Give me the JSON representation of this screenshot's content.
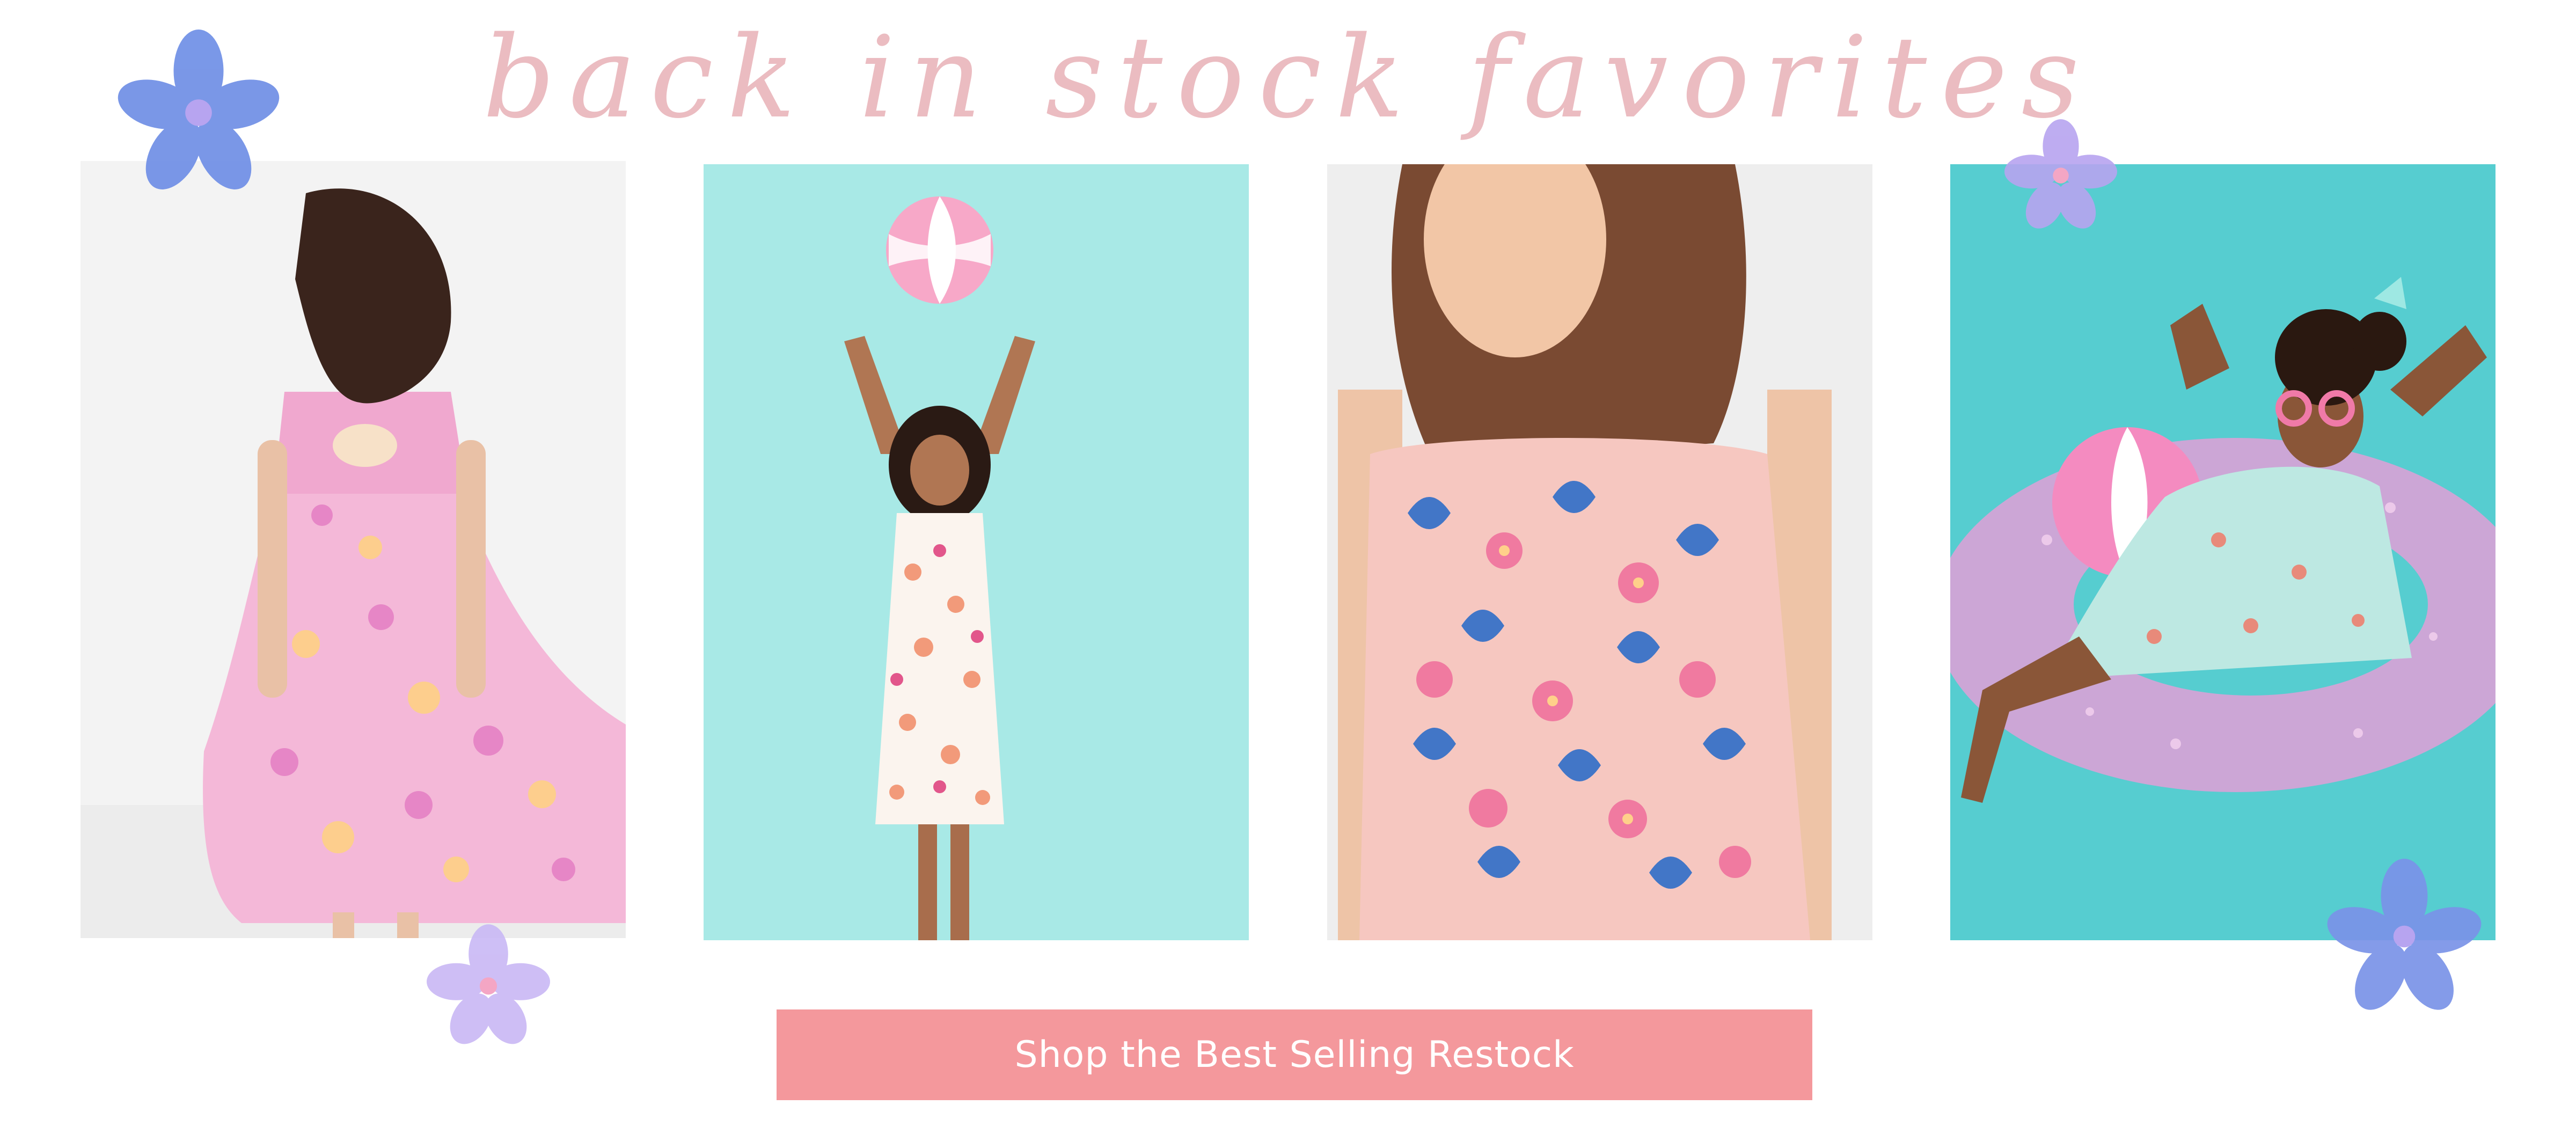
{
  "header": {
    "title": "back in stock favorites"
  },
  "gallery": {
    "photos": [
      {
        "subject": "Girl in pink floral tiered dress, back view",
        "background": "#f2f2f2"
      },
      {
        "subject": "Girl tossing a beach ball in a mermaid print dress",
        "background": "#a7e9e6"
      },
      {
        "subject": "Girl in blue and pink floral dress",
        "background": "#eeeeee"
      },
      {
        "subject": "Girl in mint mermaid dress on a pink glitter pool float",
        "background": "#52cdd0"
      }
    ]
  },
  "decorations": {
    "flower_colors": [
      "#6f8fe6",
      "#b7a4f0",
      "#c9b8f5",
      "#7a93e8"
    ]
  },
  "cta": {
    "label": "Shop the Best Selling Restock",
    "color": "#f4989c"
  },
  "colors": {
    "title": "#ebbcc1",
    "cta_text": "#ffffff"
  }
}
